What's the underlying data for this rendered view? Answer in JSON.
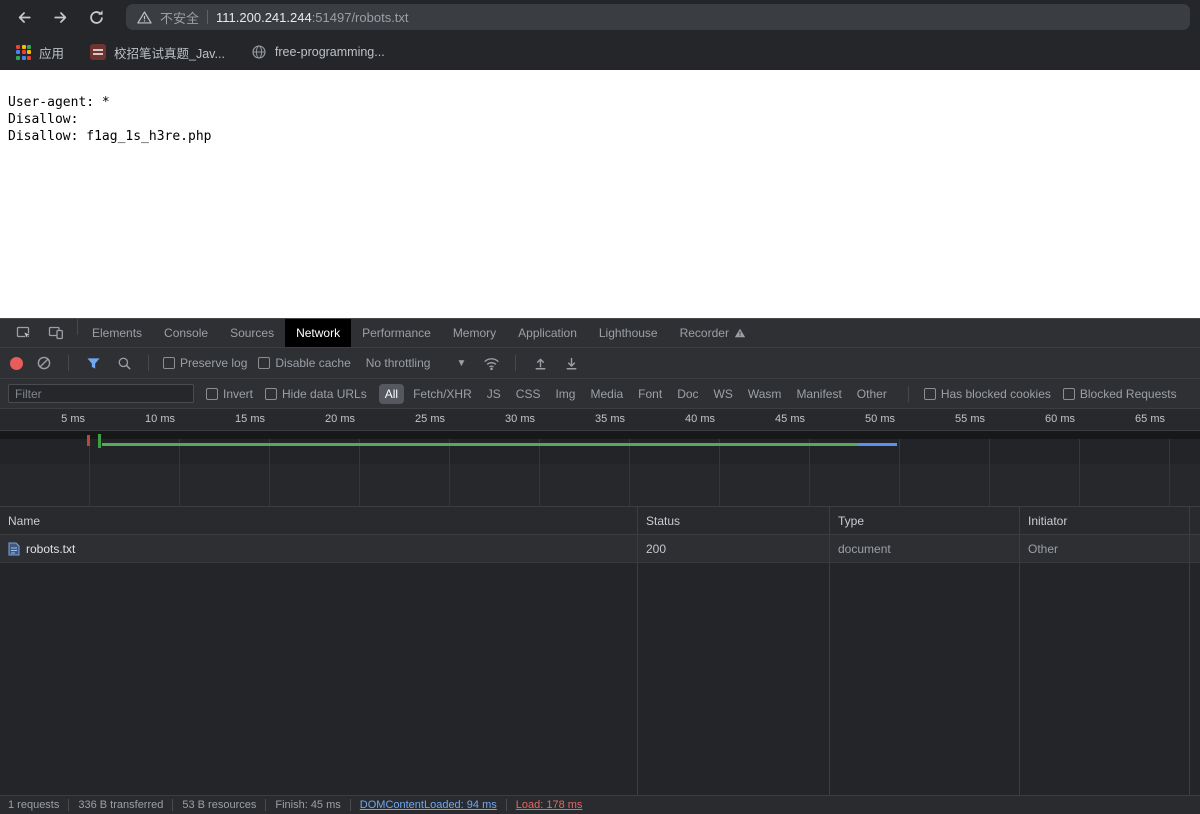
{
  "browser": {
    "security_label": "不安全",
    "url_host": "111.200.241.244",
    "url_path": ":51497/robots.txt",
    "bookmarks": {
      "apps_label": "应用",
      "items": [
        {
          "label": "校招笔试真题_Jav..."
        },
        {
          "label": "free-programming..."
        }
      ]
    }
  },
  "page": {
    "lines": [
      "User-agent: *",
      "Disallow:",
      "Disallow: f1ag_1s_h3re.php"
    ]
  },
  "devtools": {
    "tabs": [
      "Elements",
      "Console",
      "Sources",
      "Network",
      "Performance",
      "Memory",
      "Application",
      "Lighthouse",
      "Recorder"
    ],
    "selected_tab": "Network",
    "toolbar": {
      "preserve_log": "Preserve log",
      "disable_cache": "Disable cache",
      "throttling": "No throttling"
    },
    "filter": {
      "placeholder": "Filter",
      "invert": "Invert",
      "hide_data_urls": "Hide data URLs",
      "types": [
        "All",
        "Fetch/XHR",
        "JS",
        "CSS",
        "Img",
        "Media",
        "Font",
        "Doc",
        "WS",
        "Wasm",
        "Manifest",
        "Other"
      ],
      "selected_type": "All",
      "has_blocked_cookies": "Has blocked cookies",
      "blocked_requests": "Blocked Requests"
    },
    "timeline": {
      "ticks": [
        "5 ms",
        "10 ms",
        "15 ms",
        "20 ms",
        "25 ms",
        "30 ms",
        "35 ms",
        "40 ms",
        "45 ms",
        "50 ms",
        "55 ms",
        "60 ms",
        "65 ms"
      ]
    },
    "table": {
      "columns": [
        "Name",
        "Status",
        "Type",
        "Initiator"
      ],
      "rows": [
        {
          "name": "robots.txt",
          "status": "200",
          "type": "document",
          "initiator": "Other"
        }
      ]
    },
    "statusbar": {
      "requests": "1 requests",
      "transferred": "336 B transferred",
      "resources": "53 B resources",
      "finish": "Finish: 45 ms",
      "dom_content_loaded": "DOMContentLoaded: 94 ms",
      "load": "Load: 178 ms"
    }
  },
  "icons": {
    "back-icon": "←",
    "forward-icon": "→",
    "refresh-icon": "⟳",
    "not-secure-icon": "⚠",
    "apps-grid-icon": "⣿",
    "globe-icon": "◍",
    "inspect-icon": "⌖",
    "device-toolbar-icon": "▯▯",
    "record-icon": "●",
    "clear-icon": "⃠",
    "filter-funnel-icon": "▼",
    "search-icon": "🔍",
    "network-conditions-icon": "📶",
    "import-har-icon": "↥",
    "export-har-icon": "↧",
    "document-icon": "🗎",
    "warning-icon": "⚠"
  },
  "colors": {
    "accent_blue": "#6ea8f4",
    "status_red": "#e46962",
    "record_red": "#e85c5c",
    "filter_blue": "#6ea8f4",
    "waterfall_green": "#57a95c",
    "waterfall_blue": "#5b8ff2"
  }
}
